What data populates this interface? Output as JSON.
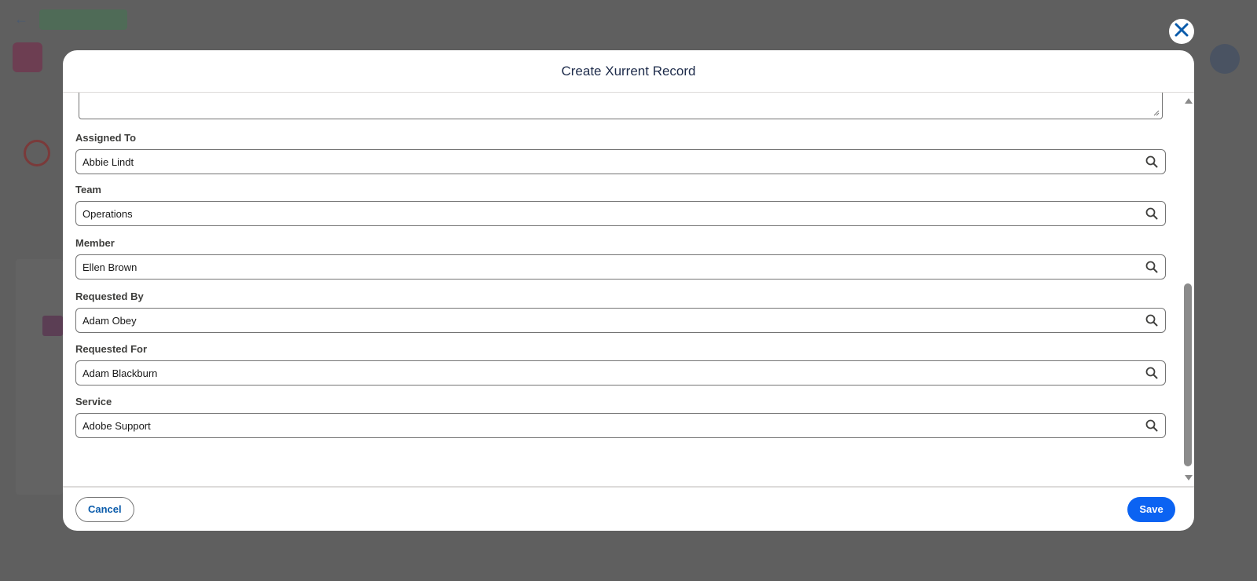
{
  "modal": {
    "title": "Create Xurrent Record",
    "fields": [
      {
        "label": "Assigned To",
        "value": "Abbie Lindt"
      },
      {
        "label": "Team",
        "value": "Operations"
      },
      {
        "label": "Member",
        "value": "Ellen Brown"
      },
      {
        "label": "Requested By",
        "value": "Adam Obey"
      },
      {
        "label": "Requested For",
        "value": "Adam Blackburn"
      },
      {
        "label": "Service",
        "value": "Adobe Support"
      }
    ],
    "footer": {
      "cancel_label": "Cancel",
      "save_label": "Save"
    }
  },
  "icons": {
    "close": "close-icon",
    "lookup": "search-icon"
  },
  "colors": {
    "overlay": "#5f5f5f",
    "brand_blue": "#0b63f2",
    "link_blue": "#0b5cab"
  }
}
